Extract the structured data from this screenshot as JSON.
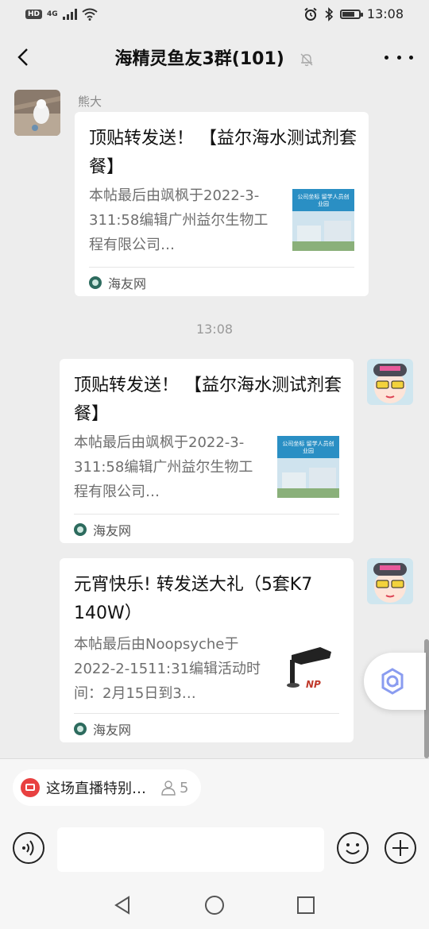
{
  "status_bar": {
    "hd": "HD",
    "network": "4G",
    "time": "13:08",
    "battery_level": 0.75
  },
  "header": {
    "title": "海精灵鱼友3群(101)",
    "back_icon": "chevron-left-icon",
    "mute_icon": "bell-off-icon",
    "more_icon": "more-dots-icon"
  },
  "messages": [
    {
      "sender": "熊大",
      "title": "顶贴转发送！ 【益尔海水测试剂套餐】",
      "description": "本帖最后由飒枫于2022-3-311:58编辑广州益尔生物工程有限公司…",
      "thumb_text": "公司坐标 留学人员创业园",
      "source": "海友网"
    },
    {
      "title": "顶贴转发送！ 【益尔海水测试剂套餐】",
      "description": "本帖最后由飒枫于2022-3-311:58编辑广州益尔生物工程有限公司…",
      "thumb_text": "公司坐标 留学人员创业园",
      "source": "海友网"
    },
    {
      "title": "元宵快乐! 转发送大礼（5套K7 140W）",
      "description": "本帖最后由Noopsyche于2022-2-1511:31编辑活动时间：2月15日到3…",
      "thumb_text": "NP",
      "source": "海友网"
    }
  ],
  "timestamp": "13:08",
  "live": {
    "text": "这场直播特别…",
    "count": "5"
  },
  "colors": {
    "background": "#ededed",
    "card": "#ffffff",
    "live_red": "#e84141",
    "source_green": "#2d6b5e"
  }
}
